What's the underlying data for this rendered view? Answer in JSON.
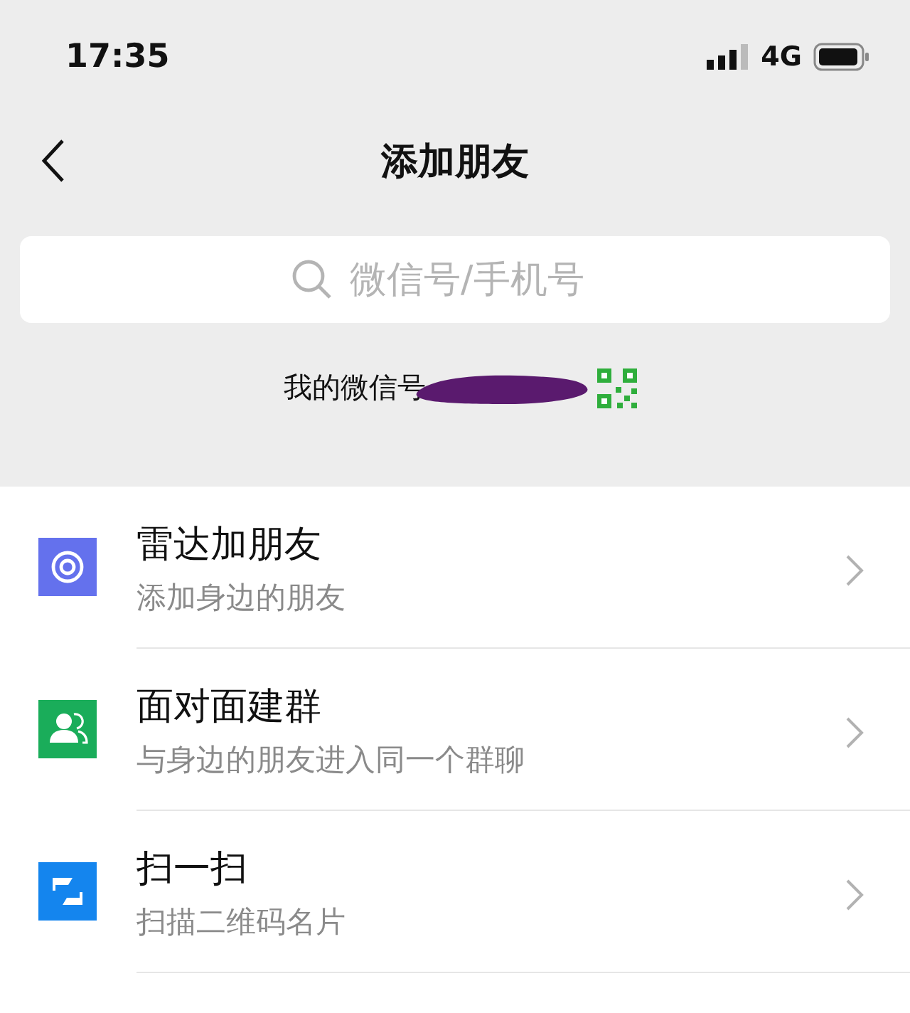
{
  "status_bar": {
    "time": "17:35",
    "network": "4G"
  },
  "nav": {
    "title": "添加朋友"
  },
  "search": {
    "placeholder": "微信号/手机号"
  },
  "my_id": {
    "label": "我的微信号",
    "redacted": true
  },
  "items": [
    {
      "kind": "radar",
      "color": "#6471ed",
      "title": "雷达加朋友",
      "subtitle": "添加身边的朋友"
    },
    {
      "kind": "group",
      "color": "#1aad5a",
      "title": "面对面建群",
      "subtitle": "与身边的朋友进入同一个群聊"
    },
    {
      "kind": "scan",
      "color": "#1485ee",
      "title": "扫一扫",
      "subtitle": "扫描二维码名片"
    }
  ]
}
